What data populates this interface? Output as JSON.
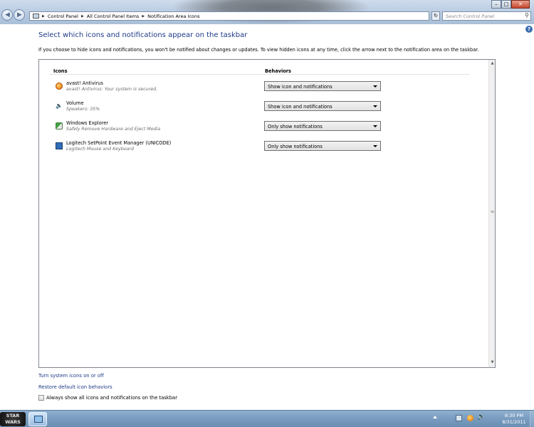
{
  "window": {
    "breadcrumb": [
      "Control Panel",
      "All Control Panel Items",
      "Notification Area Icons"
    ],
    "search_placeholder": "Search Control Panel",
    "minimize": "–",
    "maximize": "□",
    "close": "✕",
    "refresh": "↻"
  },
  "main": {
    "title": "Select which icons and notifications appear on the taskbar",
    "intro": "If you choose to hide icons and notifications, you won't be notified about changes or updates. To view hidden icons at any time, click the arrow next to the notification area on the taskbar.",
    "col_icons": "Icons",
    "col_behaviors": "Behaviors",
    "items": [
      {
        "name": "avast! Antivirus",
        "sub": "avast! Antivirus: Your system is secured.",
        "behavior": "Show icon and notifications",
        "icon": "avast-icon"
      },
      {
        "name": "Volume",
        "sub": "Speakers: 35%",
        "behavior": "Show icon and notifications",
        "icon": "volume-icon"
      },
      {
        "name": "Windows Explorer",
        "sub": "Safely Remove Hardware and Eject Media",
        "behavior": "Only show notifications",
        "icon": "safely-remove-icon"
      },
      {
        "name": "Logitech SetPoint Event Manager (UNICODE)",
        "sub": "Logitech Mouse and Keyboard",
        "behavior": "Only show notifications",
        "icon": "logitech-icon"
      }
    ]
  },
  "links": {
    "system_icons": "Turn system icons on or off",
    "restore": "Restore default icon behaviors"
  },
  "checkbox": {
    "label": "Always show all icons and notifications on the taskbar",
    "checked": false
  },
  "taskbar": {
    "start_label_line1": "STAR",
    "start_label_line2": "WARS",
    "time": "8:30 PM",
    "date": "8/31/2011"
  }
}
